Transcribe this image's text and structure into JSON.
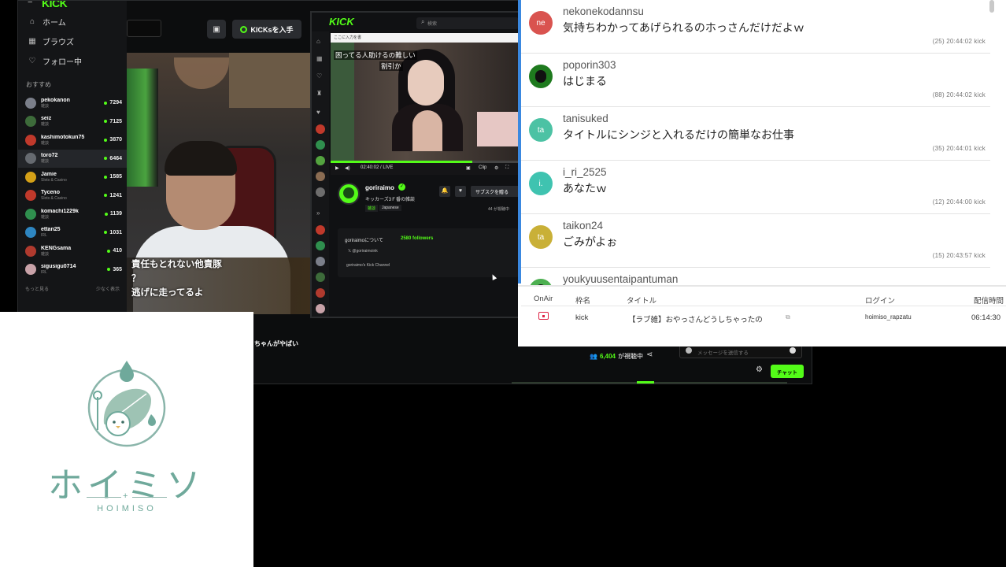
{
  "kick_main": {
    "logo": "KICK",
    "nav": [
      {
        "icon": "home-icon",
        "glyph": "⌂",
        "label": "ホーム"
      },
      {
        "icon": "browse-icon",
        "glyph": "▦",
        "label": "ブラウズ"
      },
      {
        "icon": "heart-icon",
        "glyph": "♡",
        "label": "フォロー中"
      }
    ],
    "recommended_heading": "おすすめ",
    "channels": [
      {
        "name": "pekokanon",
        "category": "雑談",
        "viewers": "7294",
        "color": "#7b7f8a"
      },
      {
        "name": "seiz",
        "category": "雑談",
        "viewers": "7125",
        "color": "#3d6b3a"
      },
      {
        "name": "kashimotokun75",
        "category": "雑談",
        "viewers": "3870",
        "color": "#c0392b"
      },
      {
        "name": "toro72",
        "category": "雑談",
        "viewers": "6464",
        "color": "#666a70"
      },
      {
        "name": "Jamie",
        "category": "Slots & Casino",
        "viewers": "1585",
        "color": "#d4a017"
      },
      {
        "name": "Tyceno",
        "category": "Slots & Casino",
        "viewers": "1241",
        "color": "#c0392b"
      },
      {
        "name": "komachi1229k",
        "category": "雑談",
        "viewers": "1139",
        "color": "#2f8f4e"
      },
      {
        "name": "ettan25",
        "category": "IRL",
        "viewers": "1031",
        "color": "#2e86c1"
      },
      {
        "name": "KENGsama",
        "category": "雑談",
        "viewers": "410",
        "color": "#b03a2e"
      },
      {
        "name": "sigusigu0714",
        "category": "IRL",
        "viewers": "365",
        "color": "#c8a2a8"
      }
    ],
    "show_more": "もっと見る",
    "show_less": "少なく表示",
    "get_kicks_label": "KICKsを入手",
    "captions": [
      "責任もとれない他責豚",
      "？",
      "逃げに走ってるよ"
    ],
    "bottom_title": "ちゃんがやばい",
    "viewer_count": "6,404",
    "viewer_suffix": "が視聴中",
    "message_placeholder": "メッセージを送信する",
    "chat_button": "チャット"
  },
  "kick_nested": {
    "logo": "KICK",
    "search_placeholder": "検索",
    "browser_tab": "ここに入力を書",
    "video_overlay_lines": [
      "困ってる人助けるの難しい",
      "割引か"
    ],
    "video_time": "02:40:02 / LIVE",
    "clip_label": "Clip",
    "streamer": "goriraimo",
    "stream_title": "キッカーズ3Ｆ番の雑談",
    "tag_category": "雑談",
    "tag_language": "Japanese",
    "subscribe_label": "サブスクを贈る",
    "viewers_label": "44 が視聴中",
    "about_title": "goriraimoについて",
    "followers": "2580 followers",
    "x_handle": "@goriraimoink",
    "channel_desc": "goriraimo's Kick Channel"
  },
  "comments": [
    {
      "user": "nekonekodannsu",
      "initials": "ne",
      "avatar_color": "#d9534f",
      "text": "気持ちわかってあげられるのホっさんだけだよｗ",
      "meta": "(25)   20:44:02   kick"
    },
    {
      "user": "poporin303",
      "initials": "",
      "avatar_color": "#1e7a1e",
      "text": "はじまる",
      "meta": "(88)   20:44:02   kick"
    },
    {
      "user": "tanisuked",
      "initials": "ta",
      "avatar_color": "#4cc2a4",
      "text": "タイトルにシンジと入れるだけの簡単なお仕事",
      "meta": "(35)   20:44:01   kick"
    },
    {
      "user": "i_ri_2525",
      "initials": "i.",
      "avatar_color": "#3fc3b0",
      "text": "あなたｗ",
      "meta": "(12)   20:44:00   kick"
    },
    {
      "user": "taikon24",
      "initials": "ta",
      "avatar_color": "#c9b037",
      "text": "ごみがよぉ",
      "meta": "(15)   20:43:57   kick"
    },
    {
      "user": "youkyuusentaipantuman",
      "initials": "",
      "avatar_color": "#4caf50",
      "text": "",
      "meta": ""
    }
  ],
  "broadcast_table": {
    "headers": [
      "OnAir",
      "枠名",
      "タイトル",
      "ログイン",
      "配信時間"
    ],
    "row": {
      "frame": "kick",
      "title": "【ラブ雑】おやっさんどうしちゃったの",
      "login": "hoimiso_rapzatu",
      "time": "06:14:30"
    }
  },
  "logo_panel": {
    "name": "ホイミソ",
    "subtitle": "HOIMISO"
  },
  "colors": {
    "kick_green": "#53fc18",
    "logo_teal": "#6fa99b"
  }
}
